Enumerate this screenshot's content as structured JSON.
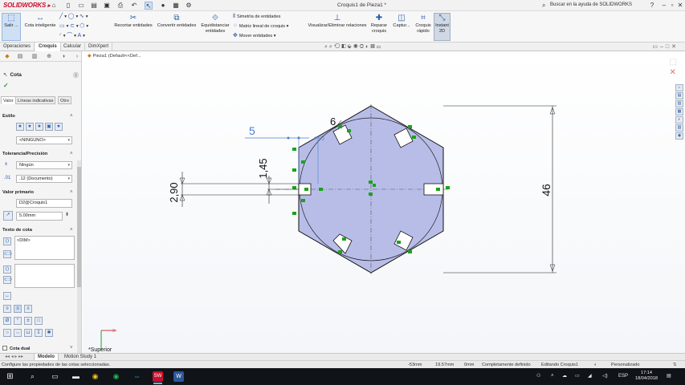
{
  "titlebar": {
    "brand": "SOLIDWORKS",
    "document_title": "Croquis1 de Pieza1 *",
    "help_search_placeholder": "Buscar en la ayuda de SOLIDWORKS",
    "help_label": "?"
  },
  "commands": {
    "exit_label": "Salir ...",
    "smart_dim_label": "Cota inteligente",
    "trim_label": "Recortar entidades",
    "convert_label": "Convertir entidades",
    "offset_label": "Equidistanciar entidades",
    "mirror_label": "Simetría de entidades",
    "linear_pattern_label": "Matriz lineal de croquis",
    "move_label": "Mover entidades",
    "relations_label": "Visualizar/Eliminar relaciones",
    "repair_label": "Reparar croquis",
    "capture_label": "Captur...",
    "quick_sketch_label": "Croquis rápido",
    "instant2d_label": "Instant 2D"
  },
  "tabs": [
    {
      "label": "Operaciones"
    },
    {
      "label": "Croquis"
    },
    {
      "label": "Calcular"
    },
    {
      "label": "DimXpert"
    }
  ],
  "property_manager": {
    "title": "Cota",
    "sub_tabs": [
      {
        "label": "Valor"
      },
      {
        "label": "Líneas indicativas"
      },
      {
        "label": "Otro"
      }
    ],
    "estilo_title": "Estilo",
    "estilo_value": "<NINGUNO>",
    "tolerancia_title": "Tolerancia/Precisión",
    "tolerance_type": "Ningún",
    "precision_value": ".12 (Documento)",
    "valor_title": "Valor primario",
    "dimension_name": "D2@Croquis1",
    "dimension_value": "5.00mm",
    "texto_title": "Texto de cota",
    "dim_text": "<DIM>",
    "format_symbols": [
      "Ø",
      "°",
      "±",
      "□"
    ],
    "dual_label": "Cota dual"
  },
  "graphics": {
    "breadcrumb": "Pieza1  (Default<<Def...",
    "view_label": "*Superior",
    "dims": {
      "d5": "5",
      "d6": "6",
      "d145": "1,45",
      "d290": "2,90",
      "d46": "46"
    }
  },
  "bottom_tabs": [
    {
      "label": "Modelo"
    },
    {
      "label": "Motion Study 1"
    }
  ],
  "statusbar": {
    "message": "Configure las propiedades de las cotas seleccionadas.",
    "x": "-53mm",
    "y": "19.57mm",
    "z": "0mm",
    "state": "Completamente definido",
    "editing": "Editando Croquis1",
    "units": "Personalizado"
  },
  "taskbar": {
    "language": "ESP",
    "time": "17:14",
    "date": "18/04/2018"
  },
  "colors": {
    "accent": "#2a5caa",
    "sketch_fill": "#b8bde8",
    "relation_green": "#1aa31a",
    "dim_blue_selected": "#4a7fd0"
  }
}
